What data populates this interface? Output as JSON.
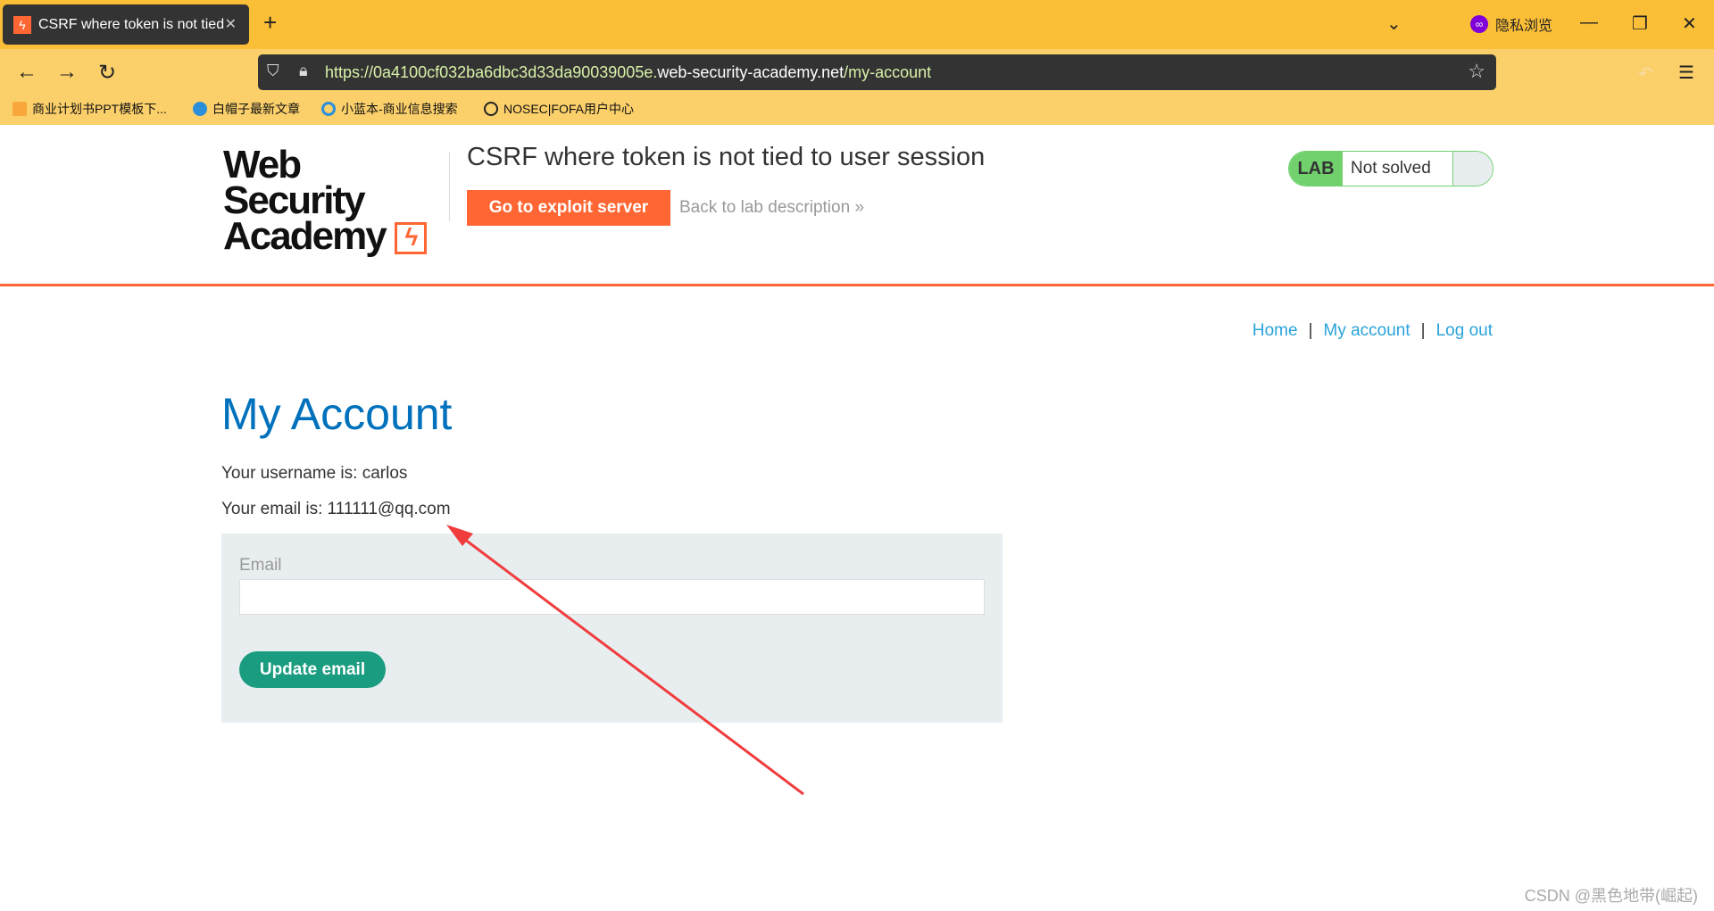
{
  "browser": {
    "tab_title": "CSRF where token is not tied",
    "private_label": "隐私浏览",
    "url_prefix": "https://0a4100cf032ba6dbc3d33da90039005e.",
    "url_host": "web-security-academy.net",
    "url_path": "/my-account",
    "bookmarks": [
      "商业计划书PPT模板下...",
      "白帽子最新文章",
      "小蓝本-商业信息搜索",
      "NOSEC|FOFA用户中心"
    ]
  },
  "header": {
    "logo_line1": "Web Security",
    "logo_line2": "Academy",
    "title": "CSRF where token is not tied to user session",
    "exploit_button": "Go to exploit server",
    "back_link": "Back to lab description",
    "lab_label": "LAB",
    "lab_status": "Not solved"
  },
  "nav": {
    "home": "Home",
    "my_account": "My account",
    "logout": "Log out",
    "sep": "|"
  },
  "main": {
    "heading": "My Account",
    "username_line": "Your username is: carlos",
    "email_line": "Your email is: 111111@qq.com",
    "email_label": "Email",
    "email_value": "",
    "update_button": "Update email"
  },
  "watermark": "CSDN @黑色地带(崛起)"
}
